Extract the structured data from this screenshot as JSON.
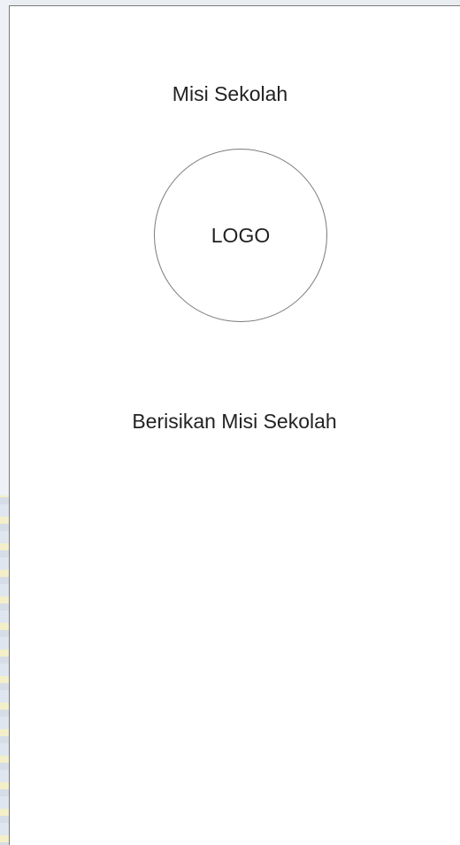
{
  "screen": {
    "title": "Misi Sekolah",
    "logo_placeholder": "LOGO",
    "content_text": "Berisikan Misi Sekolah"
  }
}
